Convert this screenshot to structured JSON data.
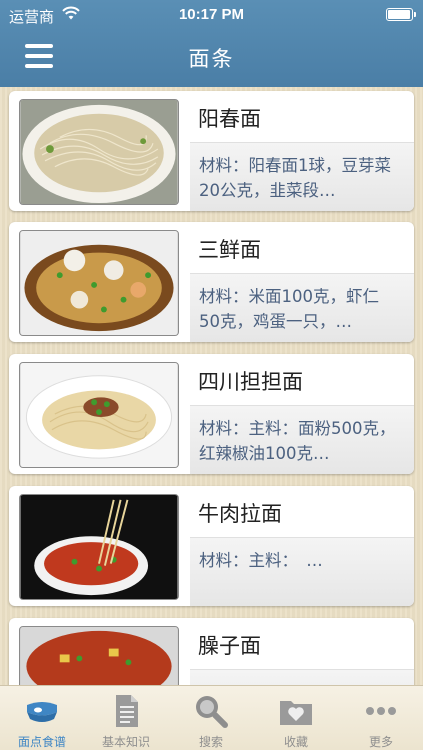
{
  "status_bar": {
    "carrier": "运营商",
    "time": "10:17 PM",
    "battery_level": 0.95
  },
  "nav": {
    "title": "面条",
    "menu_icon": "hamburger-icon"
  },
  "recipes": [
    {
      "title": "阳春面",
      "desc": "材料：阳春面1球，豆芽菜20公克，韭菜段…",
      "image": "noodle-soup-photo"
    },
    {
      "title": "三鲜面",
      "desc": "材料：米面100克，虾仁50克，鸡蛋一只，…",
      "image": "seafood-noodle-photo"
    },
    {
      "title": "四川担担面",
      "desc": "材料：主料：面粉500克，红辣椒油100克…",
      "image": "dandan-noodle-photo"
    },
    {
      "title": "牛肉拉面",
      "desc": "材料：主料：　…",
      "image": "beef-lamian-photo"
    },
    {
      "title": "臊子面",
      "desc": "",
      "image": "saozi-noodle-photo"
    }
  ],
  "tabs": [
    {
      "label": "面点食谱",
      "icon": "dish-icon",
      "active": true
    },
    {
      "label": "基本知识",
      "icon": "document-icon",
      "active": false
    },
    {
      "label": "搜索",
      "icon": "search-icon",
      "active": false
    },
    {
      "label": "收藏",
      "icon": "favorites-folder-icon",
      "active": false
    },
    {
      "label": "更多",
      "icon": "more-dots-icon",
      "active": false
    }
  ],
  "colors": {
    "nav_bar": "#4f84ac",
    "tab_active": "#3f86c4",
    "tab_inactive": "#8f8f8f",
    "desc_text": "#4c6180"
  }
}
